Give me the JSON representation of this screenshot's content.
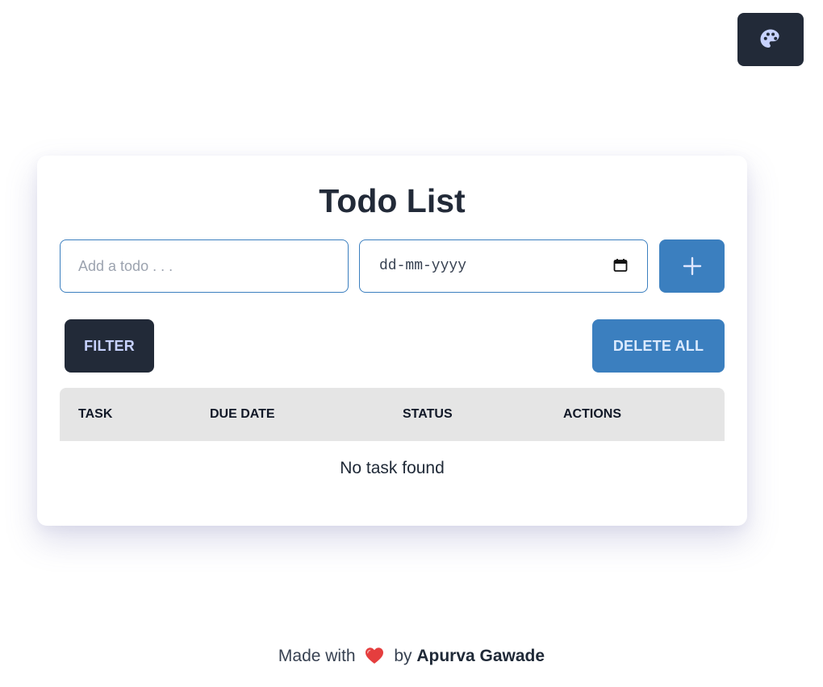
{
  "theme_toggle": {
    "icon": "palette-icon",
    "color": "#222a38"
  },
  "card": {
    "title": "Todo List",
    "todo_input": {
      "placeholder": "Add a todo . . .",
      "value": ""
    },
    "date_input": {
      "placeholder": "dd-mm-yyyy",
      "icon": "calendar-icon"
    },
    "add_button": {
      "icon": "plus-icon",
      "color": "#3b7fbf"
    },
    "filter_button": {
      "label": "FILTER",
      "color": "#222a38"
    },
    "delete_all_button": {
      "label": "DELETE ALL",
      "color": "#3b7fbf"
    },
    "table": {
      "columns": [
        "TASK",
        "DUE DATE",
        "STATUS",
        "ACTIONS"
      ],
      "rows": [],
      "empty_text": "No task found"
    }
  },
  "footer": {
    "prefix": "Made with",
    "icon": "heart-icon",
    "middle": "by",
    "author": "Apurva Gawade"
  }
}
